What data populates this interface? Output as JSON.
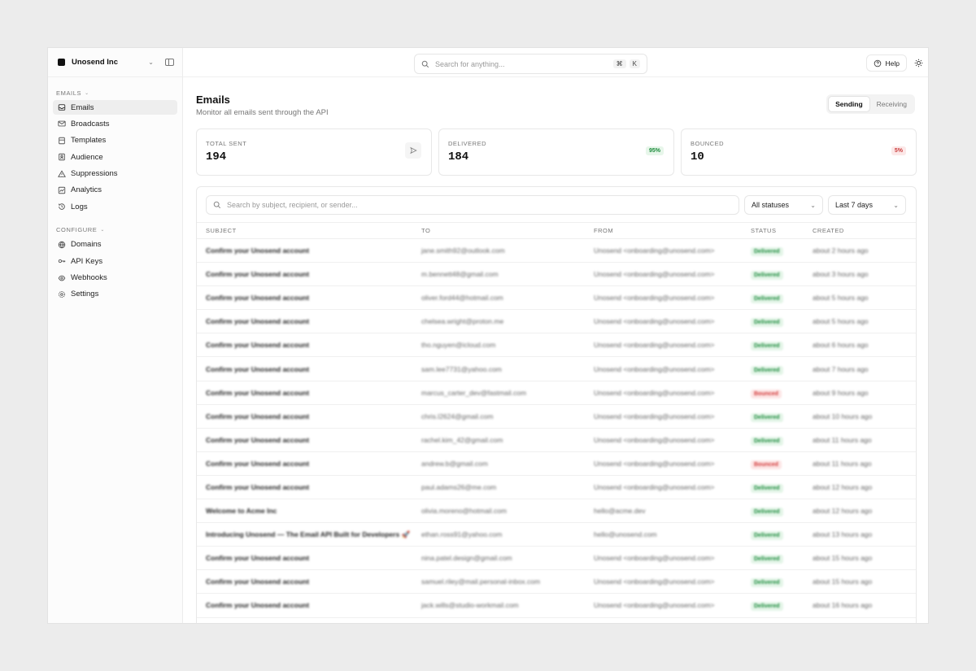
{
  "sidebar": {
    "org_name": "Unosend Inc",
    "sections": [
      {
        "label": "EMAILS",
        "items": [
          {
            "label": "Emails",
            "icon": "inbox-icon",
            "active": true
          },
          {
            "label": "Broadcasts",
            "icon": "mail-icon",
            "active": false
          },
          {
            "label": "Templates",
            "icon": "template-icon",
            "active": false
          },
          {
            "label": "Audience",
            "icon": "contacts-icon",
            "active": false
          },
          {
            "label": "Suppressions",
            "icon": "warning-icon",
            "active": false
          },
          {
            "label": "Analytics",
            "icon": "chart-icon",
            "active": false
          },
          {
            "label": "Logs",
            "icon": "history-icon",
            "active": false
          }
        ]
      },
      {
        "label": "CONFIGURE",
        "items": [
          {
            "label": "Domains",
            "icon": "globe-icon",
            "active": false
          },
          {
            "label": "API Keys",
            "icon": "key-icon",
            "active": false
          },
          {
            "label": "Webhooks",
            "icon": "webhook-icon",
            "active": false
          },
          {
            "label": "Settings",
            "icon": "gear-icon",
            "active": false
          }
        ]
      }
    ]
  },
  "topbar": {
    "search_placeholder": "Search for anything...",
    "shortcut_keys": [
      "⌘",
      "K"
    ],
    "help_label": "Help"
  },
  "header": {
    "title": "Emails",
    "subtitle": "Monitor all emails sent through the API",
    "tabs": [
      {
        "label": "Sending",
        "active": true
      },
      {
        "label": "Receiving",
        "active": false
      }
    ]
  },
  "stats": [
    {
      "label": "TOTAL SENT",
      "value": "194",
      "badge": null
    },
    {
      "label": "DELIVERED",
      "value": "184",
      "badge": "95%"
    },
    {
      "label": "BOUNCED",
      "value": "10",
      "badge": "5%"
    }
  ],
  "filters": {
    "search_placeholder": "Search by subject, recipient, or sender...",
    "status_filter": "All statuses",
    "date_filter": "Last 7 days"
  },
  "table": {
    "columns": [
      "SUBJECT",
      "TO",
      "FROM",
      "STATUS",
      "CREATED"
    ],
    "rows": [
      {
        "subject": "Confirm your Unosend account",
        "to": "jane.smith92@outlook.com",
        "from": "Unosend <onboarding@unosend.com>",
        "status": "Delivered",
        "created": "about 2 hours ago"
      },
      {
        "subject": "Confirm your Unosend account",
        "to": "m.bennett48@gmail.com",
        "from": "Unosend <onboarding@unosend.com>",
        "status": "Delivered",
        "created": "about 3 hours ago"
      },
      {
        "subject": "Confirm your Unosend account",
        "to": "oliver.ford44@hotmail.com",
        "from": "Unosend <onboarding@unosend.com>",
        "status": "Delivered",
        "created": "about 5 hours ago"
      },
      {
        "subject": "Confirm your Unosend account",
        "to": "chelsea.wright@proton.me",
        "from": "Unosend <onboarding@unosend.com>",
        "status": "Delivered",
        "created": "about 5 hours ago"
      },
      {
        "subject": "Confirm your Unosend account",
        "to": "tho.nguyen@icloud.com",
        "from": "Unosend <onboarding@unosend.com>",
        "status": "Delivered",
        "created": "about 6 hours ago"
      },
      {
        "subject": "Confirm your Unosend account",
        "to": "sam.lee7731@yahoo.com",
        "from": "Unosend <onboarding@unosend.com>",
        "status": "Delivered",
        "created": "about 7 hours ago"
      },
      {
        "subject": "Confirm your Unosend account",
        "to": "marcus_carter_dev@fastmail.com",
        "from": "Unosend <onboarding@unosend.com>",
        "status": "Bounced",
        "created": "about 9 hours ago"
      },
      {
        "subject": "Confirm your Unosend account",
        "to": "chris.l2624@gmail.com",
        "from": "Unosend <onboarding@unosend.com>",
        "status": "Delivered",
        "created": "about 10 hours ago"
      },
      {
        "subject": "Confirm your Unosend account",
        "to": "rachel.kim_42@gmail.com",
        "from": "Unosend <onboarding@unosend.com>",
        "status": "Delivered",
        "created": "about 11 hours ago"
      },
      {
        "subject": "Confirm your Unosend account",
        "to": "andrew.b@gmail.com",
        "from": "Unosend <onboarding@unosend.com>",
        "status": "Bounced",
        "created": "about 11 hours ago"
      },
      {
        "subject": "Confirm your Unosend account",
        "to": "paul.adams26@me.com",
        "from": "Unosend <onboarding@unosend.com>",
        "status": "Delivered",
        "created": "about 12 hours ago"
      },
      {
        "subject": "Welcome to Acme Inc",
        "to": "olivia.moreno@hotmail.com",
        "from": "hello@acme.dev",
        "status": "Delivered",
        "created": "about 12 hours ago"
      },
      {
        "subject": "Introducing Unosend — The Email API Built for Developers 🚀",
        "to": "ethan.ross91@yahoo.com",
        "from": "hello@unosend.com",
        "status": "Delivered",
        "created": "about 13 hours ago"
      },
      {
        "subject": "Confirm your Unosend account",
        "to": "nina.patel.design@gmail.com",
        "from": "Unosend <onboarding@unosend.com>",
        "status": "Delivered",
        "created": "about 15 hours ago"
      },
      {
        "subject": "Confirm your Unosend account",
        "to": "samuel.riley@mail.personal-inbox.com",
        "from": "Unosend <onboarding@unosend.com>",
        "status": "Delivered",
        "created": "about 15 hours ago"
      },
      {
        "subject": "Confirm your Unosend account",
        "to": "jack.wills@studio-workmail.com",
        "from": "Unosend <onboarding@unosend.com>",
        "status": "Delivered",
        "created": "about 16 hours ago"
      }
    ]
  }
}
